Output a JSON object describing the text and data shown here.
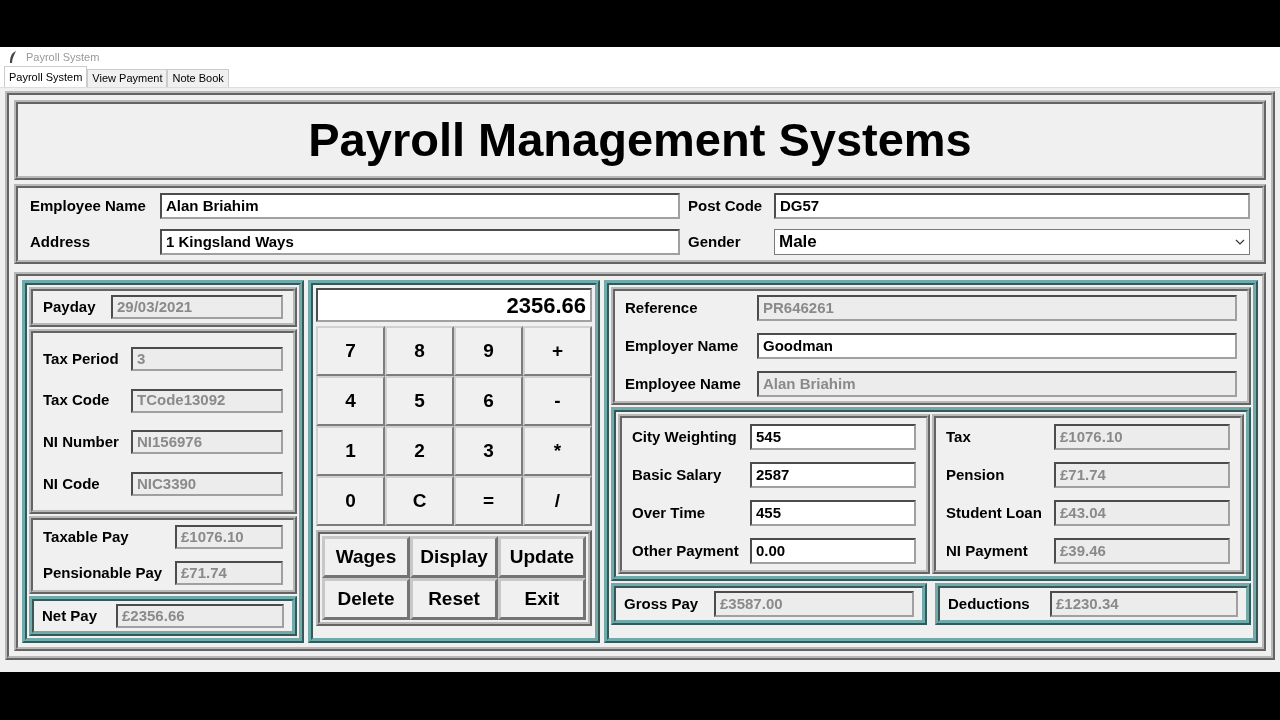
{
  "window": {
    "title": "Payroll System"
  },
  "tabs": [
    {
      "label": "Payroll System",
      "selected": true
    },
    {
      "label": "View Payment",
      "selected": false
    },
    {
      "label": "Note Book",
      "selected": false
    }
  ],
  "heading": "Payroll Management Systems",
  "employee_fields": [
    {
      "label": "Employee Name",
      "value": "Alan Briahim",
      "kind": "text"
    },
    {
      "label": "Post Code",
      "value": "DG57",
      "kind": "text"
    },
    {
      "label": "Address",
      "value": "1 Kingsland Ways",
      "kind": "text"
    },
    {
      "label": "Gender",
      "value": "Male",
      "kind": "dropdown"
    }
  ],
  "payday": {
    "label": "Payday",
    "value": "29/03/2021",
    "readonly": true
  },
  "tax_fields": [
    {
      "label": "Tax Period",
      "value": "3",
      "readonly": true
    },
    {
      "label": "Tax Code",
      "value": "TCode13092",
      "readonly": true
    },
    {
      "label": "NI Number",
      "value": "NI156976",
      "readonly": true
    },
    {
      "label": "NI Code",
      "value": "NIC3390",
      "readonly": true
    }
  ],
  "pay_fields": [
    {
      "label": "Taxable Pay",
      "value": "£1076.10",
      "readonly": true
    },
    {
      "label": "Pensionable Pay",
      "value": "£71.74",
      "readonly": true
    }
  ],
  "net_pay": {
    "label": "Net Pay",
    "value": "£2356.66",
    "readonly": true
  },
  "calculator": {
    "display": "2356.66",
    "keys": [
      "7",
      "8",
      "9",
      "+",
      "4",
      "5",
      "6",
      "-",
      "1",
      "2",
      "3",
      "*",
      "0",
      "C",
      "=",
      "/"
    ]
  },
  "actions": [
    "Wages",
    "Display",
    "Update",
    "Delete",
    "Reset",
    "Exit"
  ],
  "reference_fields": [
    {
      "label": "Reference",
      "value": "PR646261",
      "readonly": true
    },
    {
      "label": "Employer Name",
      "value": "Goodman",
      "readonly": false
    },
    {
      "label": "Employee Name",
      "value": "Alan Briahim",
      "readonly": true
    }
  ],
  "earnings": [
    {
      "label": "City Weighting",
      "value": "545",
      "readonly": false
    },
    {
      "label": "Basic Salary",
      "value": "2587",
      "readonly": false
    },
    {
      "label": "Over Time",
      "value": "455",
      "readonly": false
    },
    {
      "label": "Other Payment",
      "value": "0.00",
      "readonly": false
    }
  ],
  "deductions": [
    {
      "label": "Tax",
      "value": "£1076.10",
      "readonly": true
    },
    {
      "label": "Pension",
      "value": "£71.74",
      "readonly": true
    },
    {
      "label": "Student Loan",
      "value": "£43.04",
      "readonly": true
    },
    {
      "label": "NI Payment",
      "value": "£39.46",
      "readonly": true
    }
  ],
  "totals": [
    {
      "label": "Gross Pay",
      "value": "£3587.00",
      "readonly": true
    },
    {
      "label": "Deductions",
      "value": "£1230.34",
      "readonly": true
    }
  ]
}
